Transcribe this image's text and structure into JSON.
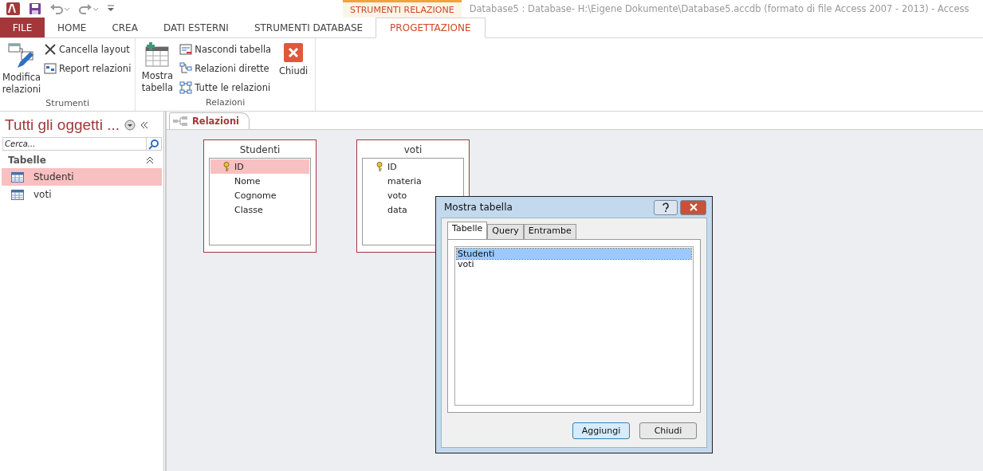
{
  "window": {
    "title": "Database5 : Database- H:\\Eigene Dokumente\\Database5.accdb (formato di file Access 2007 - 2013) - Access",
    "contextual_tab": "STRUMENTI RELAZIONE"
  },
  "ribbon_tabs": [
    {
      "label": "FILE",
      "kind": "file",
      "selected": false
    },
    {
      "label": "HOME",
      "kind": "normal",
      "selected": false
    },
    {
      "label": "CREA",
      "kind": "normal",
      "selected": false
    },
    {
      "label": "DATI ESTERNI",
      "kind": "normal",
      "selected": false
    },
    {
      "label": "STRUMENTI DATABASE",
      "kind": "normal",
      "selected": false
    },
    {
      "label": "PROGETTAZIONE",
      "kind": "contextual",
      "selected": true
    }
  ],
  "ribbon_groups": [
    {
      "label": "Strumenti",
      "commands": [
        {
          "label": "Modifica relazioni",
          "kind": "large"
        },
        {
          "kind": "stack",
          "items": [
            {
              "label": "Cancella layout"
            },
            {
              "label": "Report relazioni"
            }
          ]
        }
      ]
    },
    {
      "label": "Relazioni",
      "commands": [
        {
          "label": "Mostra tabella",
          "kind": "large"
        },
        {
          "kind": "stack",
          "items": [
            {
              "label": "Nascondi tabella"
            },
            {
              "label": "Relazioni dirette"
            },
            {
              "label": "Tutte le relazioni"
            }
          ]
        },
        {
          "label": "Chiudi",
          "kind": "large"
        }
      ]
    }
  ],
  "nav": {
    "title": "Tutti gli oggetti ...",
    "search": {
      "placeholder": "Cerca..."
    },
    "group": {
      "label": "Tabelle",
      "expanded": true
    },
    "items": [
      {
        "label": "Studenti",
        "selected": true
      },
      {
        "label": "voti",
        "selected": false
      }
    ]
  },
  "document_tab": {
    "label": "Relazioni"
  },
  "tables": [
    {
      "name": "Studenti",
      "fields": [
        {
          "name": "ID",
          "key": true,
          "selected": true
        },
        {
          "name": "Nome",
          "key": false,
          "selected": false
        },
        {
          "name": "Cognome",
          "key": false,
          "selected": false
        },
        {
          "name": "Classe",
          "key": false,
          "selected": false
        }
      ]
    },
    {
      "name": "voti",
      "fields": [
        {
          "name": "ID",
          "key": true,
          "selected": false
        },
        {
          "name": "materia",
          "key": false,
          "selected": false
        },
        {
          "name": "voto",
          "key": false,
          "selected": false
        },
        {
          "name": "data",
          "key": false,
          "selected": false
        }
      ]
    }
  ],
  "dialog": {
    "title": "Mostra tabella",
    "tabs": [
      {
        "label": "Tabelle",
        "selected": true
      },
      {
        "label": "Query",
        "selected": false
      },
      {
        "label": "Entrambe",
        "selected": false
      }
    ],
    "list": [
      {
        "label": "Studenti",
        "selected": true
      },
      {
        "label": "voti",
        "selected": false
      }
    ],
    "buttons": [
      {
        "label": "Aggiungi",
        "default": true
      },
      {
        "label": "Chiudi",
        "default": false
      }
    ]
  }
}
